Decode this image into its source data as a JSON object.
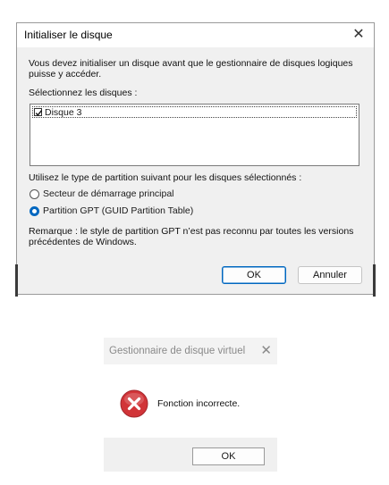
{
  "init_dialog": {
    "title": "Initialiser le disque",
    "intro": "Vous devez initialiser un disque avant que le gestionnaire de disques logiques puisse y accéder.",
    "select_label": "Sélectionnez les disques :",
    "disks": [
      {
        "label": "Disque 3",
        "checked": true
      }
    ],
    "partition_prompt": "Utilisez le type de partition suivant pour les disques sélectionnés :",
    "options": [
      {
        "label": "Secteur de démarrage principal",
        "selected": false
      },
      {
        "label": "Partition GPT (GUID Partition Table)",
        "selected": true
      }
    ],
    "note": "Remarque : le style de partition GPT n’est pas reconnu par toutes les versions précédentes de Windows.",
    "ok_label": "OK",
    "cancel_label": "Annuler"
  },
  "error_dialog": {
    "title": "Gestionnaire de disque virtuel",
    "message": "Fonction incorrecte.",
    "ok_label": "OK",
    "icon": "error-icon",
    "icon_color": "#d13438"
  }
}
